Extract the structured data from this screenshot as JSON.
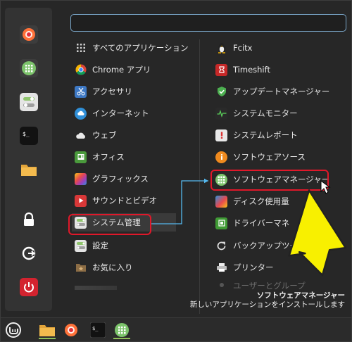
{
  "favorites": [
    "firefox-icon",
    "software-manager-icon",
    "system-settings-icon",
    "terminal-icon",
    "files-icon"
  ],
  "session": [
    "lock-screen-icon",
    "logout-icon",
    "shutdown-icon"
  ],
  "search": {
    "placeholder": ""
  },
  "categories": [
    {
      "label": "すべてのアプリケーション",
      "icon": "grid-icon"
    },
    {
      "label": "Chrome アプリ",
      "icon": "chrome-icon"
    },
    {
      "label": "アクセサリ",
      "icon": "scissors-icon"
    },
    {
      "label": "インターネット",
      "icon": "cloud-icon"
    },
    {
      "label": "ウェブ",
      "icon": "web-cloud-icon"
    },
    {
      "label": "オフィス",
      "icon": "office-icon"
    },
    {
      "label": "グラフィックス",
      "icon": "graphics-icon"
    },
    {
      "label": "サウンドとビデオ",
      "icon": "media-icon"
    },
    {
      "label": "システム管理",
      "icon": "admin-icon"
    },
    {
      "label": "設定",
      "icon": "settings-icon"
    },
    {
      "label": "お気に入り",
      "icon": "star-folder-icon"
    }
  ],
  "apps": [
    {
      "label": "Fcitx",
      "icon": "penguin-icon"
    },
    {
      "label": "Timeshift",
      "icon": "timeshift-icon"
    },
    {
      "label": "アップデートマネージャー",
      "icon": "shield-icon"
    },
    {
      "label": "システムモニター",
      "icon": "monitor-icon"
    },
    {
      "label": "システムレポート",
      "icon": "report-icon"
    },
    {
      "label": "ソフトウェアソース",
      "icon": "info-icon"
    },
    {
      "label": "ソフトウェアマネージャー",
      "icon": "software-manager-icon"
    },
    {
      "label": "ディスク使用量",
      "icon": "disk-icon"
    },
    {
      "label": "ドライバーマネ",
      "icon": "driver-icon"
    },
    {
      "label": "バックアップツール",
      "icon": "backup-icon"
    },
    {
      "label": "プリンター",
      "icon": "printer-icon"
    },
    {
      "label": "ユーザーとグループ",
      "icon": "users-icon"
    }
  ],
  "tooltip": {
    "title": "ソフトウェアマネージャー",
    "description": "新しいアプリケーションをインストールします"
  },
  "taskbar": [
    "mint-menu-icon",
    "files-icon",
    "firefox-icon",
    "terminal-icon",
    "software-manager-icon"
  ]
}
